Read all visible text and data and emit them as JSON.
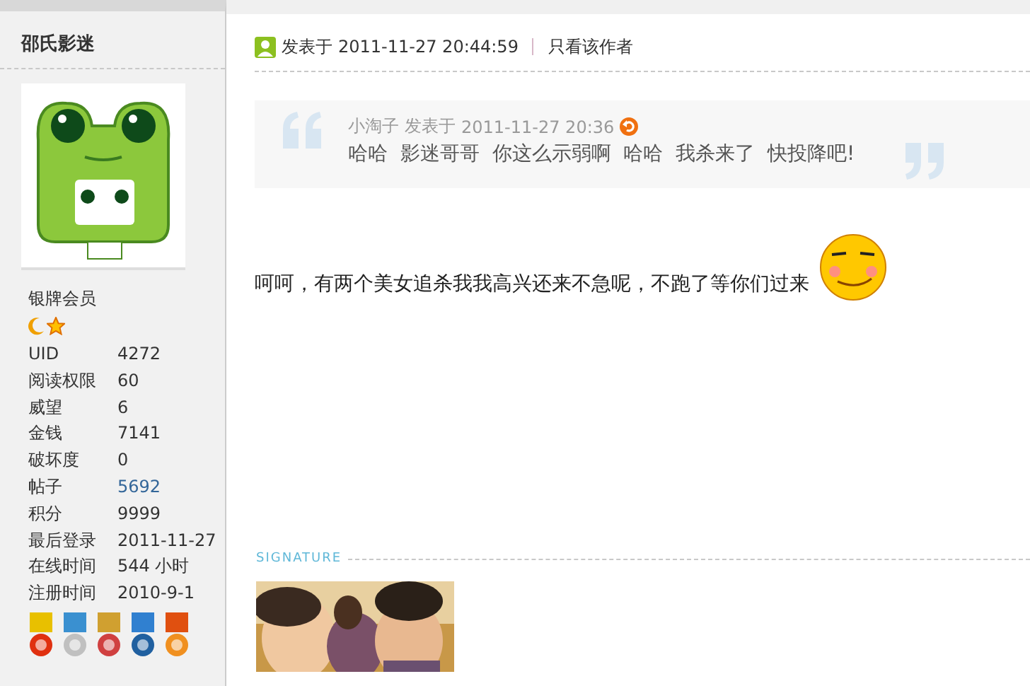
{
  "user": {
    "name": "邵氏影迷",
    "rank": "银牌会员",
    "stats": [
      {
        "label": "UID",
        "value": "4272",
        "kind": "text"
      },
      {
        "label": "阅读权限",
        "value": "60",
        "kind": "text"
      },
      {
        "label": "威望",
        "value": "6",
        "kind": "text"
      },
      {
        "label": "金钱",
        "value": "7141",
        "kind": "text"
      },
      {
        "label": "破坏度",
        "value": "0",
        "kind": "text"
      },
      {
        "label": "帖子",
        "value": "5692",
        "kind": "link"
      },
      {
        "label": "积分",
        "value": "9999",
        "kind": "text"
      },
      {
        "label": "最后登录",
        "value": "2011-11-27",
        "kind": "text"
      },
      {
        "label": "在线时间",
        "value": "544 小时",
        "kind": "text"
      },
      {
        "label": "注册时间",
        "value": "2010-9-1",
        "kind": "text"
      }
    ]
  },
  "post": {
    "posted_label": "发表于",
    "time": "2011-11-27 20:44:59",
    "author_only": "只看该作者",
    "quote": {
      "author": "小淘子",
      "posted_label": "发表于",
      "time": "2011-11-27 20:36",
      "text": "哈哈  影迷哥哥  你这么示弱啊  哈哈  我杀来了  快投降吧!"
    },
    "body": "呵呵，有两个美女追杀我我高兴还来不急呢，不跑了等你们过来",
    "signature": {
      "label": "SIGNATURE"
    }
  }
}
